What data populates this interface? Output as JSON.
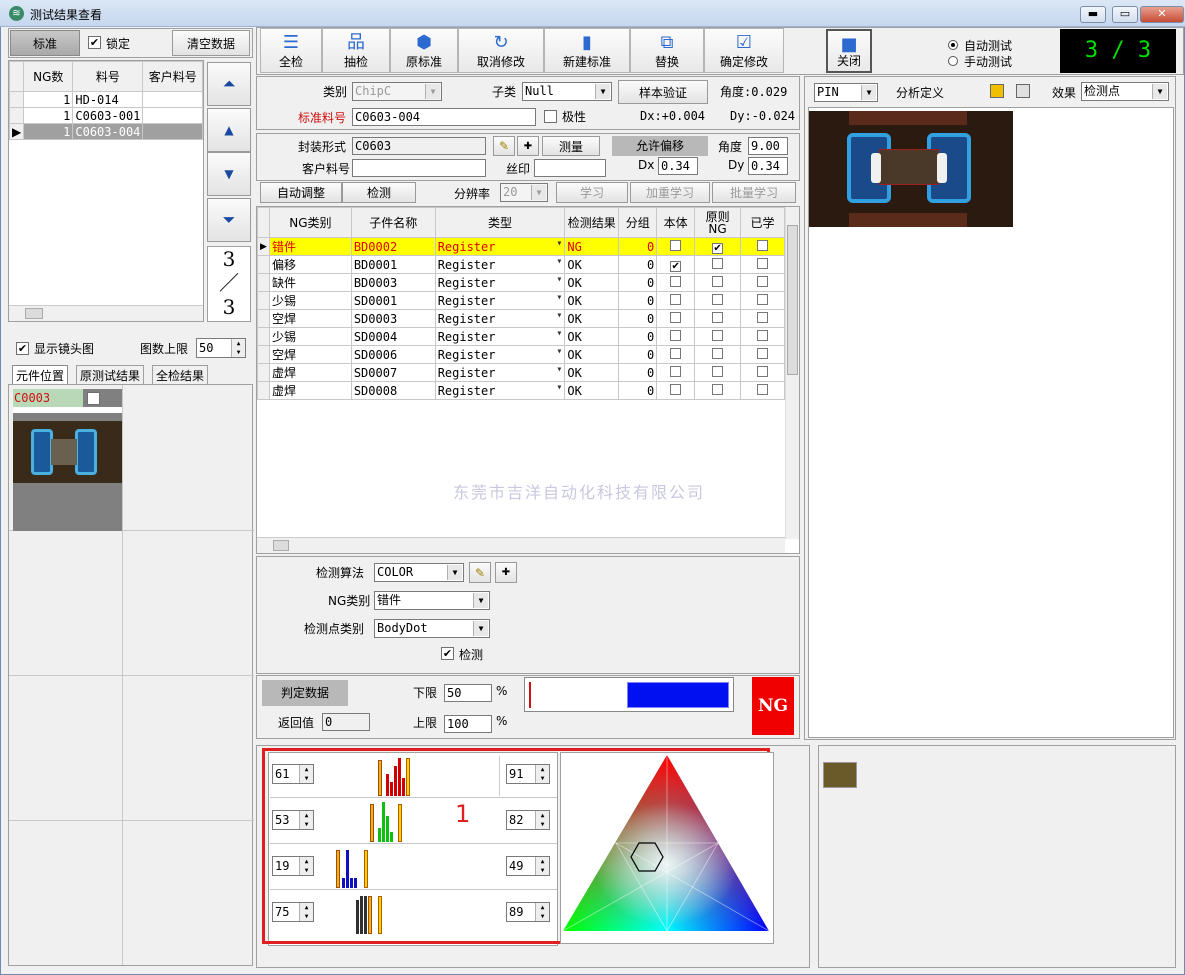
{
  "window": {
    "title": "测试结果查看",
    "min": "▬",
    "max": "▭",
    "close": "✕"
  },
  "left_top": {
    "tab_standard": "标准",
    "lock_label": "锁定",
    "lock_checked": "✔",
    "clear_button": "清空数据"
  },
  "list": {
    "headers": [
      "NG数",
      "料号",
      "客户料号"
    ],
    "rows": [
      {
        "marker": "",
        "ng": "1",
        "part": "HD-014",
        "cust": ""
      },
      {
        "marker": "",
        "ng": "1",
        "part": "C0603-001",
        "cust": ""
      },
      {
        "marker": "▶",
        "ng": "1",
        "part": "C0603-004",
        "cust": ""
      }
    ]
  },
  "nav": {
    "top": "⏶",
    "up": "▲",
    "down": "▼",
    "bottom": "⏷",
    "page_current": "3",
    "page_sep": "／",
    "page_total": "3"
  },
  "left_mid": {
    "show_lens_label": "显示镜头图",
    "show_lens_checked": "✔",
    "max_images_label": "图数上限",
    "max_images_value": "50"
  },
  "left_tabs": [
    "元件位置",
    "原测试结果",
    "全检结果"
  ],
  "thumb": {
    "label": "C0003"
  },
  "toolbar": [
    {
      "label": "全检",
      "icon": "list-icon",
      "glyph": "☰"
    },
    {
      "label": "抽检",
      "icon": "network-icon",
      "glyph": "品"
    },
    {
      "label": "原标准",
      "icon": "cube-icon",
      "glyph": "⬢"
    },
    {
      "label": "取消修改",
      "icon": "undo-icon",
      "glyph": "↻"
    },
    {
      "label": "新建标准",
      "icon": "new-doc-icon",
      "glyph": "▮"
    },
    {
      "label": "替换",
      "icon": "replace-icon",
      "glyph": "⧉"
    },
    {
      "label": "确定修改",
      "icon": "confirm-icon",
      "glyph": "☑"
    },
    {
      "label": "关闭",
      "icon": "close-square-icon",
      "glyph": "■"
    }
  ],
  "mode": {
    "auto": "自动测试",
    "manual": "手动测试"
  },
  "counter": "3 / 3",
  "form": {
    "category_label": "类别",
    "category_value": "ChipC",
    "subcategory_label": "子类",
    "subcategory_value": "Null",
    "sample_verify": "样本验证",
    "angle_label": "角度:0.029",
    "std_part_label": "标准料号",
    "std_part_value": "C0603-004",
    "polarity_label": "极性",
    "dx_label": "Dx:+0.004",
    "dy_label": "Dy:-0.024",
    "package_label": "封装形式",
    "package_value": "C0603",
    "measure_button": "测量",
    "plus": "✚",
    "allow_offset": "允许偏移",
    "angle2_label": "角度",
    "angle2_value": "9.00",
    "customer_part_label": "客户料号",
    "customer_part_value": "",
    "silk_label": "丝印",
    "silk_value": "",
    "dx2_label": "Dx",
    "dx2_value": "0.34",
    "dy2_label": "Dy",
    "dy2_value": "0.34",
    "auto_adjust": "自动调整",
    "detect": "检测",
    "resolution_label": "分辨率",
    "resolution_value": "20",
    "learn": "学习",
    "add_learn": "加重学习",
    "batch_learn": "批量学习"
  },
  "table": {
    "headers": [
      "NG类别",
      "子件名称",
      "类型",
      "检测结果",
      "分组",
      "本体",
      "原则NG",
      "已学"
    ],
    "rows": [
      {
        "marker": "▶",
        "ng": "错件",
        "name": "BD0002",
        "type": "Register",
        "result": "NG",
        "group": "0",
        "body": "",
        "orig": "✔",
        "learned": ""
      },
      {
        "marker": "",
        "ng": "偏移",
        "name": "BD0001",
        "type": "Register",
        "result": "OK",
        "group": "0",
        "body": "✔",
        "orig": "",
        "learned": ""
      },
      {
        "marker": "",
        "ng": "缺件",
        "name": "BD0003",
        "type": "Register",
        "result": "OK",
        "group": "0",
        "body": "",
        "orig": "",
        "learned": ""
      },
      {
        "marker": "",
        "ng": "少锡",
        "name": "SD0001",
        "type": "Register",
        "result": "OK",
        "group": "0",
        "body": "",
        "orig": "",
        "learned": ""
      },
      {
        "marker": "",
        "ng": "空焊",
        "name": "SD0003",
        "type": "Register",
        "result": "OK",
        "group": "0",
        "body": "",
        "orig": "",
        "learned": ""
      },
      {
        "marker": "",
        "ng": "少锡",
        "name": "SD0004",
        "type": "Register",
        "result": "OK",
        "group": "0",
        "body": "",
        "orig": "",
        "learned": ""
      },
      {
        "marker": "",
        "ng": "空焊",
        "name": "SD0006",
        "type": "Register",
        "result": "OK",
        "group": "0",
        "body": "",
        "orig": "",
        "learned": ""
      },
      {
        "marker": "",
        "ng": "虚焊",
        "name": "SD0007",
        "type": "Register",
        "result": "OK",
        "group": "0",
        "body": "",
        "orig": "",
        "learned": ""
      },
      {
        "marker": "",
        "ng": "虚焊",
        "name": "SD0008",
        "type": "Register",
        "result": "OK",
        "group": "0",
        "body": "",
        "orig": "",
        "learned": ""
      }
    ],
    "watermark": "东莞市吉洋自动化科技有限公司"
  },
  "algo": {
    "algo_label": "检测算法",
    "algo_value": "COLOR",
    "ng_type_label": "NG类别",
    "ng_type_value": "错件",
    "point_type_label": "检测点类别",
    "point_type_value": "BodyDot",
    "detect_label": "检测",
    "detect_checked": "✔"
  },
  "judge": {
    "judge_button": "判定数据",
    "return_label": "返回值",
    "return_value": "0",
    "lower_label": "下限",
    "lower_value": "50",
    "upper_label": "上限",
    "upper_value": "100",
    "pct": "%",
    "result": "NG"
  },
  "right": {
    "pin_value": "PIN",
    "analysis_def": "分析定义",
    "effect_label": "效果",
    "effect_value": "检测点"
  },
  "color": {
    "annotation": "1",
    "rows": [
      {
        "low": "61",
        "high": "91"
      },
      {
        "low": "53",
        "high": "82"
      },
      {
        "low": "19",
        "high": "49"
      },
      {
        "low": "75",
        "high": "89"
      }
    ]
  }
}
